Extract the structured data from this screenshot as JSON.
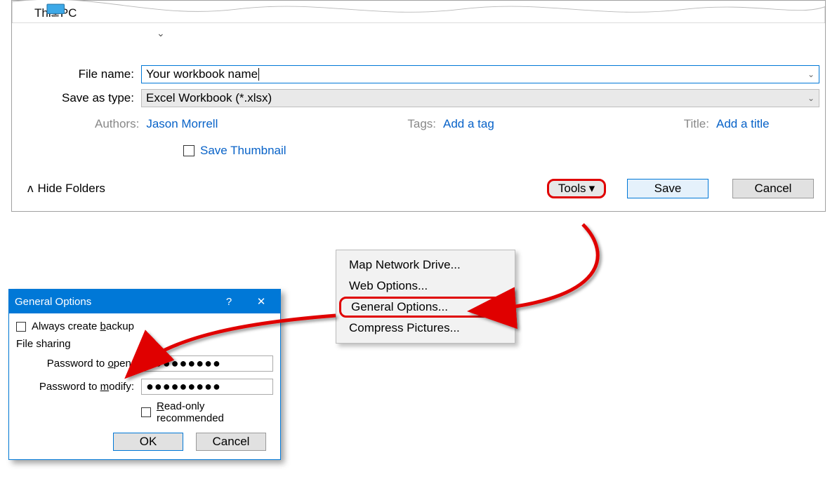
{
  "saveas": {
    "location_label": "This PC",
    "filename_label": "File name:",
    "filename_value": "Your workbook name",
    "type_label": "Save as type:",
    "type_value": "Excel Workbook (*.xlsx)",
    "authors_label": "Authors:",
    "authors_value": "Jason Morrell",
    "tags_label": "Tags:",
    "tags_placeholder": "Add a tag",
    "title_label": "Title:",
    "title_placeholder": "Add a title",
    "save_thumbnail_label": "Save Thumbnail",
    "hide_folders_label": "Hide Folders",
    "tools_label": "Tools",
    "save_label": "Save",
    "cancel_label": "Cancel"
  },
  "tools_menu": {
    "items": [
      "Map Network Drive...",
      "Web Options...",
      "General Options...",
      "Compress Pictures..."
    ]
  },
  "general_options": {
    "title": "General Options",
    "help_symbol": "?",
    "close_symbol": "✕",
    "always_backup_label": "Always create backup",
    "file_sharing_label": "File sharing",
    "password_open_label": "Password to open:",
    "password_modify_label": "Password to modify:",
    "password_value": "●●●●●●●●●",
    "read_only_label": "Read-only recommended",
    "ok_label": "OK",
    "cancel_label": "Cancel"
  }
}
